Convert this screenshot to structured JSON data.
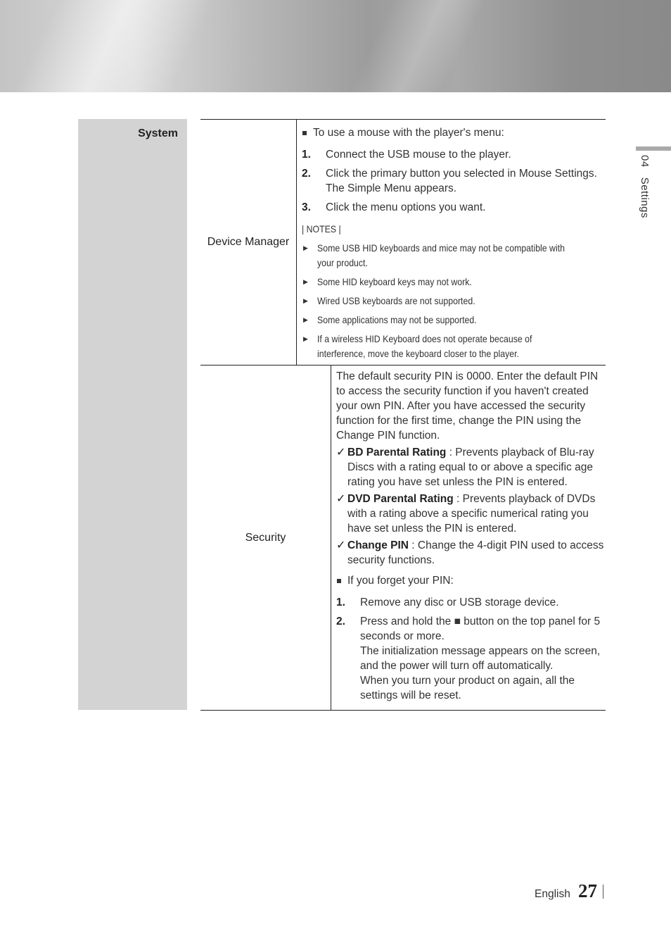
{
  "header": {
    "banner": "decorative-metallic-banner"
  },
  "side_tab": {
    "chapter_num": "04",
    "chapter_title": "Settings"
  },
  "category": "System",
  "rows": [
    {
      "name": "Device Manager",
      "intro": "To use a mouse with the player's menu:",
      "steps": [
        {
          "num": "1.",
          "text": "Connect the USB mouse to the player."
        },
        {
          "num": "2.",
          "text": "Click the primary button you selected in Mouse Settings. The Simple Menu appears."
        },
        {
          "num": "3.",
          "text": "Click the menu options you want."
        }
      ],
      "notes_heading": "| NOTES |",
      "notes": [
        "Some USB HID keyboards and mice may not be compatible with your product.",
        "Some HID keyboard keys may not work.",
        "Wired USB keyboards are not supported.",
        "Some applications may not be supported.",
        "If a wireless HID Keyboard does not operate because of interference, move the keyboard closer to the player."
      ]
    },
    {
      "name": "Security",
      "intro": "The default security PIN is 0000. Enter the default PIN to access the security function if you haven't created your own PIN. After you have accessed the security function for the first time, change the PIN using the Change PIN function.",
      "checks": [
        {
          "term": "BD Parental Rating",
          "desc": " : Prevents playback of Blu-ray Discs with a rating equal to or above a specific age rating you have set unless the PIN is entered."
        },
        {
          "term": "DVD Parental Rating",
          "desc": " : Prevents playback of DVDs with a rating above a specific numerical rating you have set unless the PIN is entered."
        },
        {
          "term": "Change PIN",
          "desc": " : Change the 4-digit PIN used to access security functions."
        }
      ],
      "forgot_heading": "If you forget your PIN:",
      "forgot_steps": [
        {
          "num": "1.",
          "text": "Remove any disc or USB storage device."
        },
        {
          "num": "2.",
          "text_a": "Press and hold the ",
          "icon": "■",
          "text_b": " button on the top panel for 5 seconds or more.",
          "extra1": "The initialization message appears on the screen, and the power will turn off automatically.",
          "extra2": "When you turn your product on again, all the settings will be reset."
        }
      ]
    }
  ],
  "footer": {
    "language": "English",
    "page_number": "27"
  }
}
